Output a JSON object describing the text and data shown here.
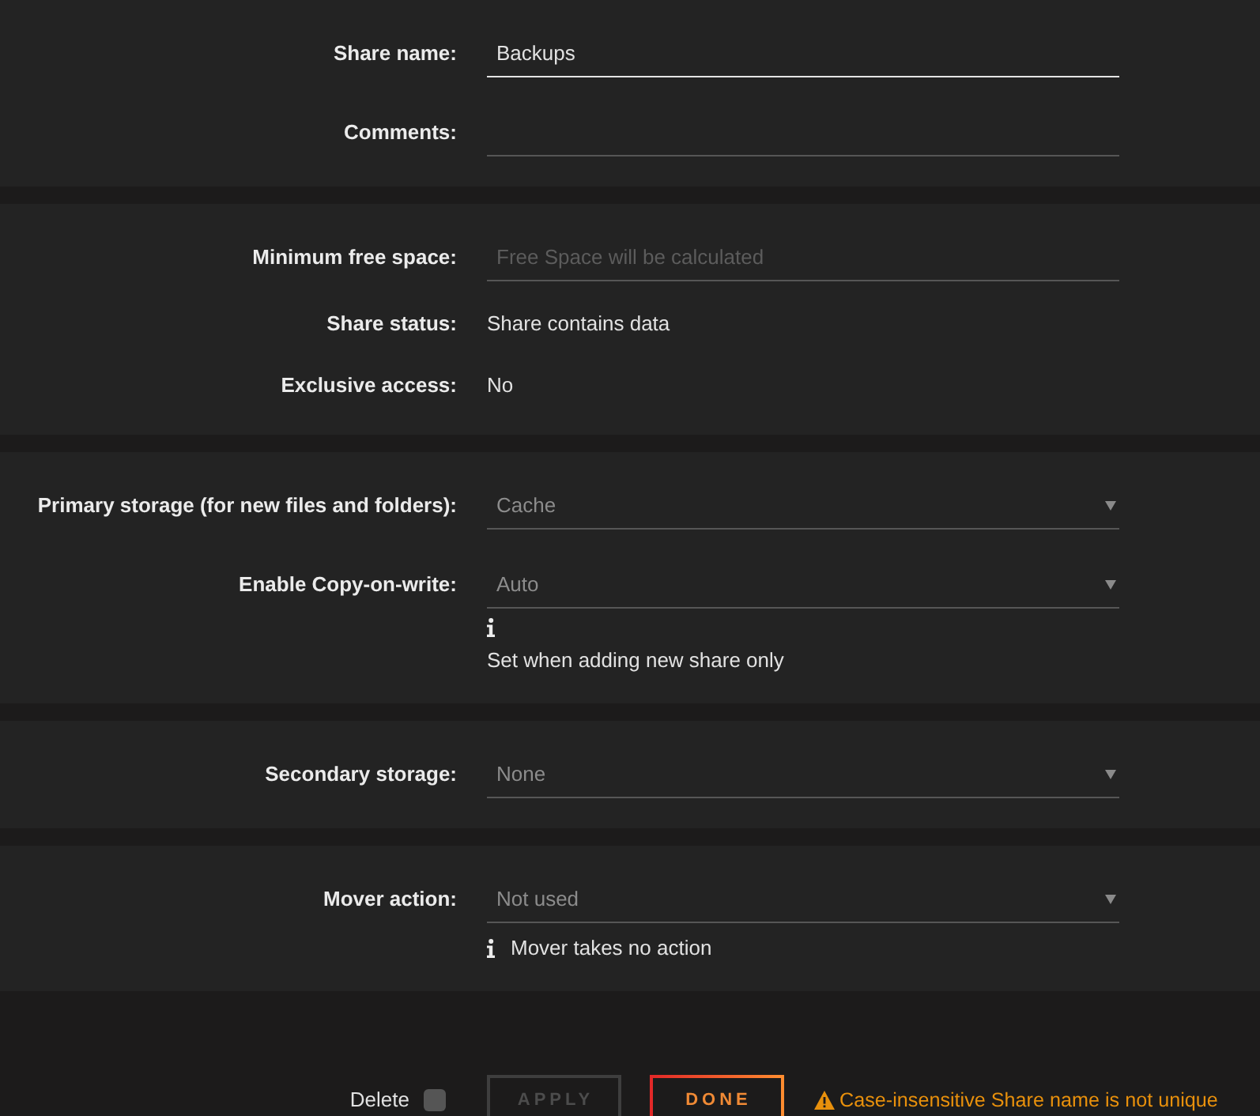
{
  "sections": [
    {
      "rows": [
        {
          "kind": "input",
          "label": "Share name:",
          "value": "Backups",
          "focused": true
        },
        {
          "kind": "input",
          "label": "Comments:",
          "focused": false
        }
      ]
    },
    {
      "rows": [
        {
          "kind": "input",
          "label": "Minimum free space:",
          "placeholder": "Free Space will be calculated",
          "focused": false
        },
        {
          "kind": "text",
          "label": "Share status:",
          "value": "Share contains data"
        },
        {
          "kind": "text",
          "label": "Exclusive access:",
          "value": "No"
        }
      ]
    },
    {
      "rows": [
        {
          "kind": "select",
          "label": "Primary storage (for new files and folders):",
          "value": "Cache"
        },
        {
          "kind": "select",
          "label": "Enable Copy-on-write:",
          "value": "Auto",
          "note": {
            "kind": "stacked",
            "text": "Set when adding new share only"
          }
        }
      ]
    },
    {
      "rows": [
        {
          "kind": "select",
          "label": "Secondary storage:",
          "value": "None"
        }
      ]
    },
    {
      "rows": [
        {
          "kind": "select",
          "label": "Mover action:",
          "value": "Not used",
          "note": {
            "kind": "inline",
            "text": "Mover takes no action"
          }
        }
      ]
    }
  ],
  "footer": {
    "delete": {
      "label": "Delete",
      "checked": false
    },
    "buttons": [
      {
        "kind": "apply",
        "label": "APPLY",
        "disabled": true
      },
      {
        "kind": "done",
        "label": "DONE",
        "disabled": false
      }
    ],
    "warning": "Case-insensitive Share name is not unique"
  }
}
